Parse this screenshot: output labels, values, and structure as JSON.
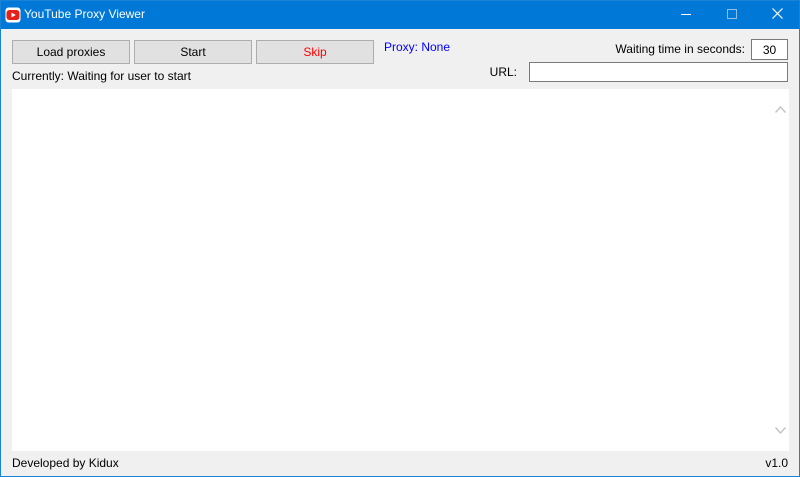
{
  "window": {
    "title": "YouTube Proxy Viewer",
    "app_icon": "youtube-icon",
    "controls": {
      "minimize_icon": "minimize-icon",
      "maximize_icon": "maximize-icon",
      "close_icon": "close-icon"
    },
    "title_bar_color": "#0078d7"
  },
  "toolbar": {
    "load_proxies_label": "Load proxies",
    "start_label": "Start",
    "skip_label": "Skip",
    "skip_color": "#ff0000"
  },
  "proxy": {
    "text": "Proxy: None",
    "color": "#0000ff"
  },
  "status": {
    "text": "Currently: Waiting for user to start"
  },
  "wait_time": {
    "label": "Waiting time in seconds:",
    "value": "30"
  },
  "url": {
    "label": "URL:",
    "value": ""
  },
  "browser": {
    "scroll_up_icon": "chevron-up-icon",
    "scroll_down_icon": "chevron-down-icon"
  },
  "footer": {
    "developer_text": "Developed by Kidux",
    "version_text": "v1.0"
  }
}
